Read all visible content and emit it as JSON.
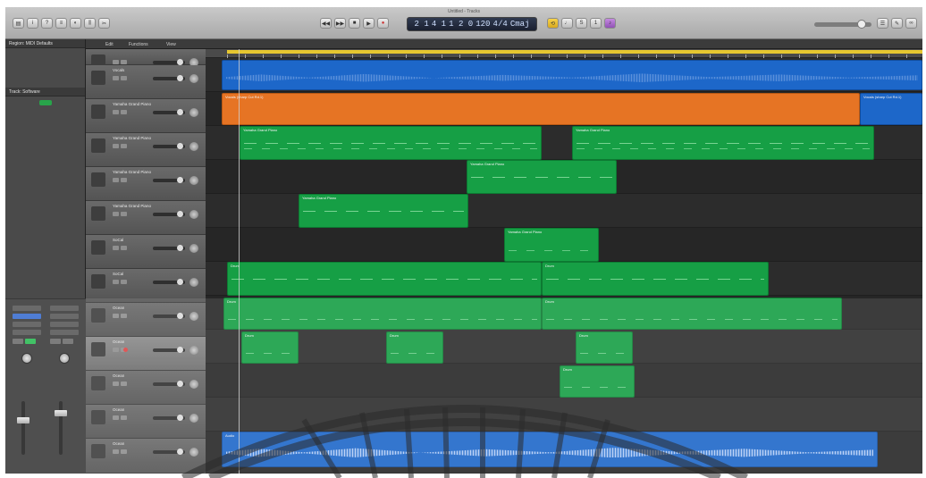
{
  "window": {
    "title": "Untitled - Tracks"
  },
  "transport": {
    "lcd_text": [
      "2 1",
      "4 1",
      "1 2 0",
      "120",
      "4/4",
      "Cmaj"
    ]
  },
  "inspector": {
    "header": "Region: MIDI Defaults",
    "track_header": "Track: Software"
  },
  "arrange_menu": {
    "edit": "Edit",
    "functions": "Functions",
    "view": "View"
  },
  "tracks": [
    {
      "name": ""
    },
    {
      "name": "Vocals"
    },
    {
      "name": "Yamaha Grand Piano"
    },
    {
      "name": "Yamaha Grand Piano"
    },
    {
      "name": "Yamaha Grand Piano"
    },
    {
      "name": "Yamaha Grand Piano"
    },
    {
      "name": "SoCal"
    },
    {
      "name": "SoCal"
    },
    {
      "name": "Ocean"
    },
    {
      "name": "Ocean"
    },
    {
      "name": "Ocean"
    },
    {
      "name": "Ocean"
    },
    {
      "name": "Ocean"
    }
  ],
  "regions": [
    {
      "name": "",
      "color": "blue"
    },
    {
      "name": "Vocals (sharp Cut Rd.1)",
      "color": "orange"
    },
    {
      "name": "Vocals (sharp Cut Rd.1)",
      "color": "blue"
    },
    {
      "name": "Yamaha Grand Piano",
      "color": "green"
    },
    {
      "name": "Yamaha Grand Piano",
      "color": "green"
    },
    {
      "name": "Yamaha Grand Piano",
      "color": "green"
    },
    {
      "name": "Yamaha Grand Piano",
      "color": "green"
    },
    {
      "name": "Yamaha Grand Piano",
      "color": "green"
    },
    {
      "name": "Drum",
      "color": "green"
    },
    {
      "name": "Drum",
      "color": "green"
    },
    {
      "name": "Drum",
      "color": "green"
    },
    {
      "name": "Drum",
      "color": "green"
    },
    {
      "name": "Drum",
      "color": "green"
    },
    {
      "name": "Drum",
      "color": "green"
    },
    {
      "name": "Drum",
      "color": "green"
    },
    {
      "name": "Drum",
      "color": "green"
    },
    {
      "name": "Audio",
      "color": "blue"
    }
  ],
  "colors": {
    "midi_region": "#169f45",
    "audio_region": "#1d67c9",
    "vocal_region": "#e67424",
    "cycle": "#e6c730"
  }
}
